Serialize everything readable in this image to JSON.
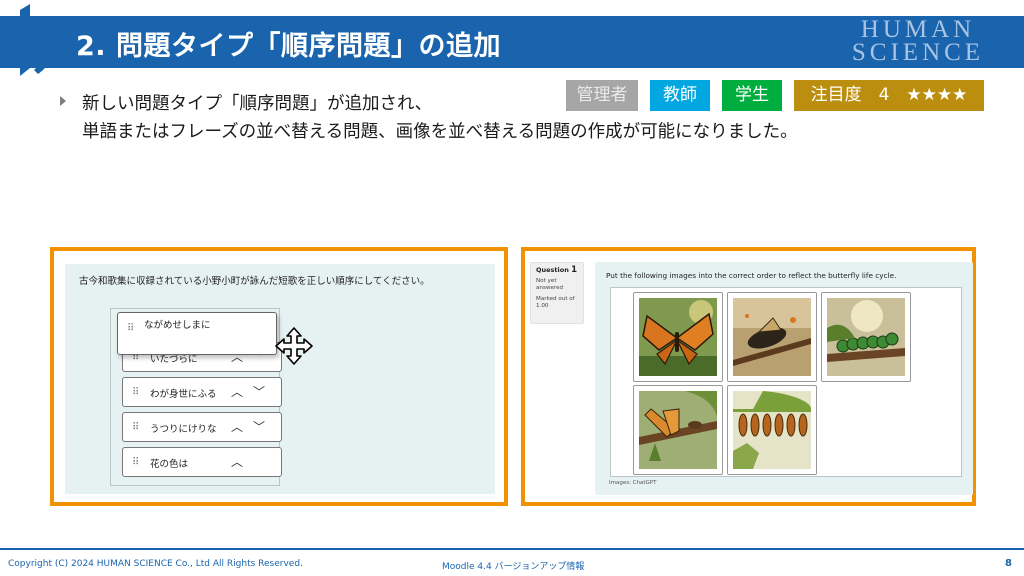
{
  "slide": {
    "title": "2. 問題タイプ「順序問題」の追加",
    "brand": "HUMAN SCIENCE",
    "bullet_line1": "新しい問題タイプ「順序問題」が追加され、",
    "bullet_line2": "単語またはフレーズの並べ替える問題、画像を並べ替える問題の作成が可能になりました。"
  },
  "badges": {
    "admin": "管理者",
    "teacher": "教師",
    "student": "学生",
    "attention": "注目度　4　★★★★"
  },
  "colors": {
    "header": "#1a64ad",
    "panel_border": "#f39200",
    "admin": "#a6a6a6",
    "teacher": "#00a7e0",
    "student": "#00ad3f",
    "attention": "#bc8e0f"
  },
  "ordering_question": {
    "prompt": "古今和歌集に収録されている小野小町が詠んだ短歌を正しい順序にしてください。",
    "dragging_item": "ながめせしまに",
    "items": [
      {
        "label": "いたづらに",
        "has_down": true
      },
      {
        "label": "わが身世にふる",
        "has_down": true
      },
      {
        "label": "うつりにけりな",
        "has_down": true
      },
      {
        "label": "花の色は",
        "has_down": false
      }
    ],
    "up_icon": "chevron-up-icon",
    "down_icon": "chevron-down-icon",
    "cursor_icon": "move-cursor-icon"
  },
  "image_question": {
    "question_label": "Question",
    "question_number": "1",
    "status": "Not yet answered",
    "marked": "Marked out of 1.00",
    "prompt": "Put the following images into the correct order to reflect the butterfly life cycle.",
    "images": [
      "butterfly-adult-image",
      "butterfly-emerging-image",
      "caterpillar-image",
      "butterfly-resting-image",
      "chrysalis-image"
    ],
    "caption": "Images: ChatGPT"
  },
  "footer": {
    "copyright": "Copyright (C) 2024 HUMAN SCIENCE Co., Ltd All Rights Reserved.",
    "subtitle": "Moodle 4.4 バージョンアップ情報",
    "page": "8"
  }
}
